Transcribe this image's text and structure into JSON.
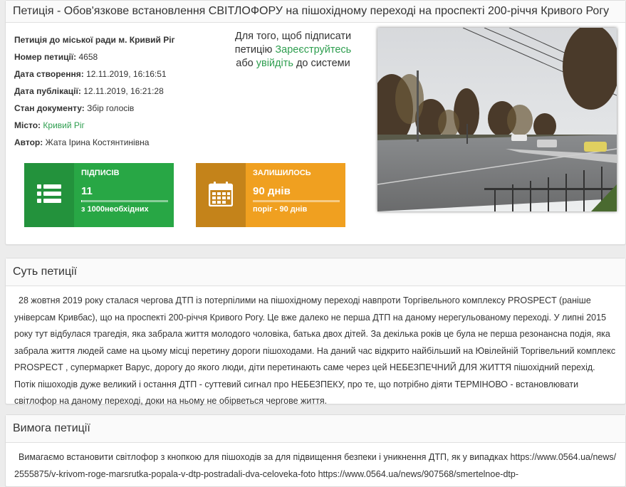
{
  "petition": {
    "title": "Петиція - Обов'язкове встановлення СВІТЛОФОРУ на пішохідному переході на проспекті 200-річчя Кривого Рогу",
    "info": [
      {
        "label": "Петиція до міської ради м. Кривий Ріг",
        "value": "",
        "link": false
      },
      {
        "label": "Номер петиції:",
        "value": "4658",
        "link": false
      },
      {
        "label": "Дата створення:",
        "value": "12.11.2019, 16:16:51",
        "link": false
      },
      {
        "label": "Дата публікації:",
        "value": "12.11.2019, 16:21:28",
        "link": false
      },
      {
        "label": "Стан документу:",
        "value": "Збір голосів",
        "link": false
      },
      {
        "label": "Місто:",
        "value": "Кривий Ріг",
        "link": true
      },
      {
        "label": "Автор:",
        "value": "Жата Ірина Костянтинівна",
        "link": false
      }
    ],
    "sign_message": {
      "part1": "Для того, щоб підписати петицію",
      "register_link": "Зареєструйтесь",
      "part2": "або",
      "login_link": "увійдіть",
      "part3": "до системи"
    },
    "signatures": {
      "label": "ПІДПИСІВ",
      "value": "11",
      "sub": "з 1000необхідних",
      "progress": 0.011,
      "color": "#28a745",
      "icon": "list-icon"
    },
    "remaining": {
      "label": "ЗАЛИШИЛОСЬ",
      "value": "90 днів",
      "sub": "поріг - 90 днів",
      "progress": 0.0,
      "color": "#f0a020",
      "icon": "calendar-icon"
    }
  },
  "essence": {
    "heading": "Суть петиції",
    "text": "28 жовтня 2019 року сталася чергова ДТП із потерпілими на пішохідному переході навпроти Торгівельного комплексу PROSPECT (раніше універсам Кривбас), що на проспекті 200-річчя Кривого Рогу. Це вже далеко не перша ДТП на даному нерегульованому переході. У липні 2015 року тут відбулася трагедія, яка забрала життя молодого чоловіка, батька двох дітей. За декілька років це була не перша резонансна подія, яка забрала життя людей саме на цьому місці перетину дороги пішоходами. На даний час відкрито найбільший на Ювілейній Торгівельний комплекс PROSPECT , супермаркет Варус, дорогу до якого люди, діти перетинають саме через цей НЕБЕЗПЕЧНИЙ ДЛЯ ЖИТТЯ пішохідний перехід. Потік пішоходів дуже великий і остання ДТП - суттевий сигнал про НЕБЕЗПЕКУ, про те, що потрібно діяти ТЕРМІНОВО - встановлювати світлофор на даному переході, доки на ньому не обірветься чергове життя."
  },
  "demand": {
    "heading": "Вимога петиції",
    "text": "Вимагаємо встановити світлофор з кнопкою для пішоходів за для підвищення безпеки і уникнення ДТП, як у випадках https://www.0564.ua/news/2555875/v-krivom-roge-marsrutka-popala-v-dtp-postradali-dva-celoveka-foto https://www.0564.ua/news/907568/smertelnoe-dtp-"
  }
}
